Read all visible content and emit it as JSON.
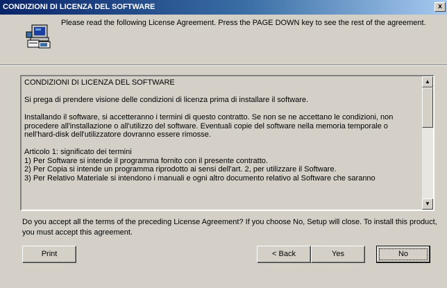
{
  "window": {
    "title": "CONDIZIONI DI LICENZA DEL SOFTWARE",
    "close_glyph": "x"
  },
  "header": {
    "icon": "setup-computer-icon",
    "intro": "Please read the following License Agreement. Press the PAGE DOWN key to see the rest of the agreement."
  },
  "license": {
    "paragraphs": [
      "CONDIZIONI DI LICENZA DEL SOFTWARE",
      "Si prega di prendere visione delle condizioni di licenza prima di installare il software.",
      "Installando il software, si accetteranno i termini di questo contratto. Se non se ne accettano le condizioni, non procedere all'installazione o all'utilizzo del software. Eventuali copie del software nella memoria temporale o nell'hard-disk dell'utilizzatore dovranno essere rimosse.",
      "Articolo 1: significato dei termini\n1) Per Software si intende il programma fornito con il presente contratto.\n2) Per Copia si intende un programma riprodotto ai sensi dell'art. 2, per utilizzare il Software.\n3) Per Relativo Materiale si intendono i manuali e ogni altro documento relativo al Software che saranno"
    ],
    "scroll_up_glyph": "▲",
    "scroll_down_glyph": "▼"
  },
  "question": "Do you accept all the terms of the preceding License Agreement? If you choose No, Setup will close. To install this product, you must accept this agreement.",
  "buttons": {
    "print": "Print",
    "back": "< Back",
    "yes": "Yes",
    "no": "No"
  }
}
